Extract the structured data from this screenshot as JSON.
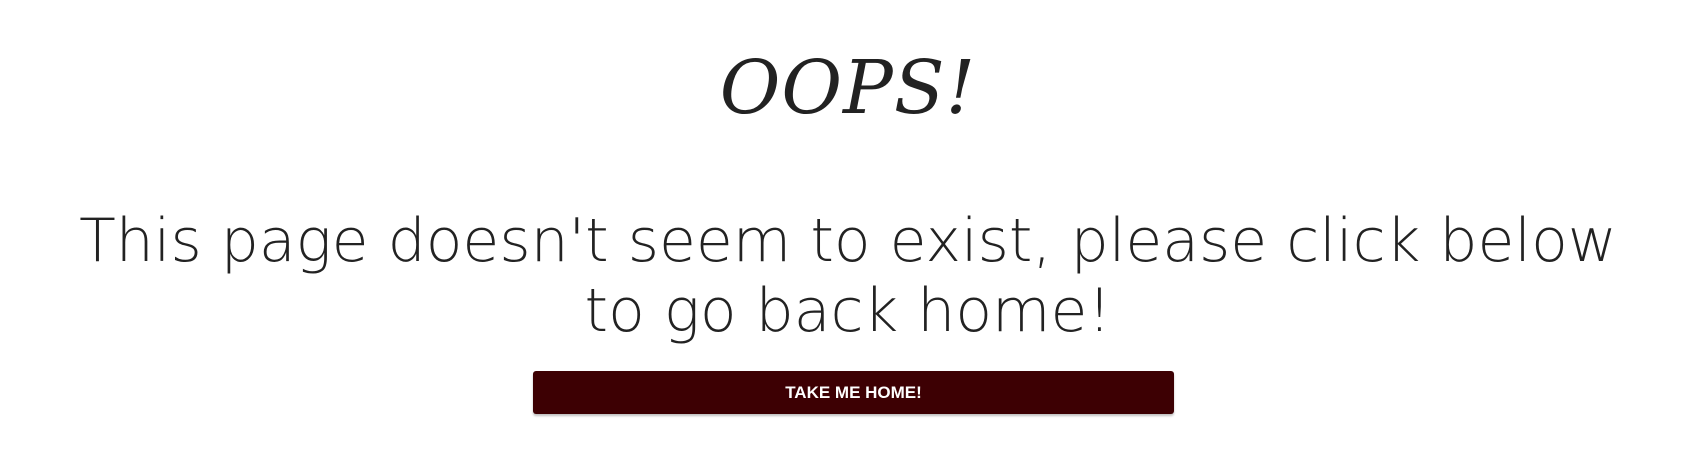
{
  "error_page": {
    "title": "OOPS!",
    "message": "This page doesn't seem to exist, please click below to go back home!",
    "button_label": "TAKE ME HOME!"
  },
  "colors": {
    "text": "#222222",
    "button_background": "#3d0003",
    "button_text": "#ffffff",
    "page_background": "#ffffff"
  }
}
